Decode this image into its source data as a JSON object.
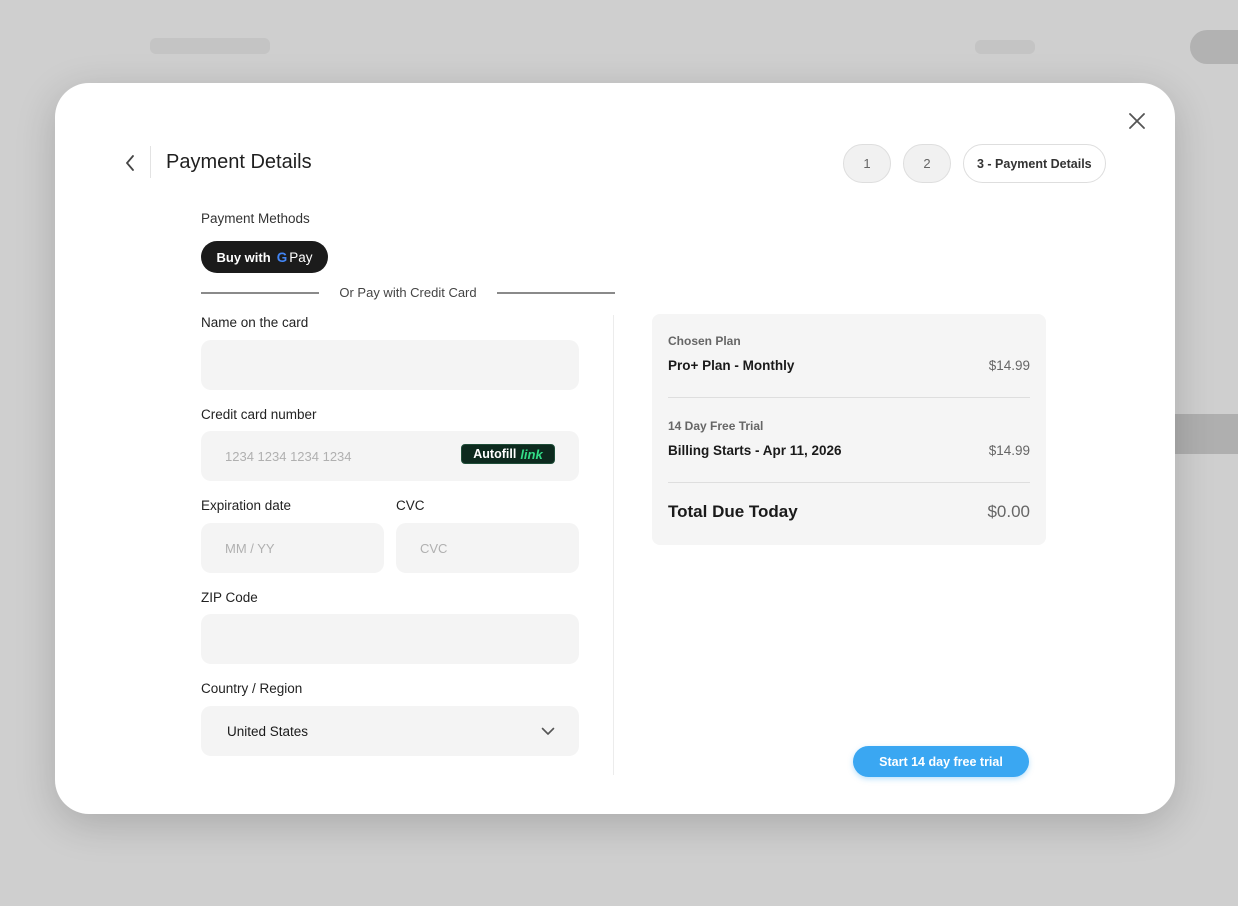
{
  "header": {
    "title": "Payment Details",
    "steps": [
      "1",
      "2",
      "3 - Payment Details"
    ]
  },
  "payment_methods": {
    "label": "Payment Methods",
    "gpay_prefix": "Buy with",
    "gpay_g": "G",
    "gpay_pay": "Pay",
    "divider_text": "Or Pay with Credit Card"
  },
  "form": {
    "name_label": "Name on the card",
    "name_value": "",
    "card_label": "Credit card number",
    "card_placeholder": "1234 1234 1234 1234",
    "autofill_label": "Autofill",
    "autofill_brand": "link",
    "exp_label": "Expiration date",
    "exp_placeholder": "MM / YY",
    "cvc_label": "CVC",
    "cvc_placeholder": "CVC",
    "zip_label": "ZIP Code",
    "zip_value": "",
    "country_label": "Country / Region",
    "country_value": "United States"
  },
  "summary": {
    "plan_caption": "Chosen Plan",
    "plan_name": "Pro+ Plan - Monthly",
    "plan_price": "$14.99",
    "trial_caption": "14 Day Free Trial",
    "trial_name": "Billing Starts - Apr 11, 2026",
    "trial_price": "$14.99",
    "total_label": "Total Due Today",
    "total_value": "$0.00"
  },
  "cta": {
    "label": "Start 14 day free trial"
  },
  "colors": {
    "accent": "#3aa7f2",
    "gpay_bg": "#1b1b1b",
    "link_green": "#33dd88",
    "field_bg": "#f4f4f4"
  }
}
